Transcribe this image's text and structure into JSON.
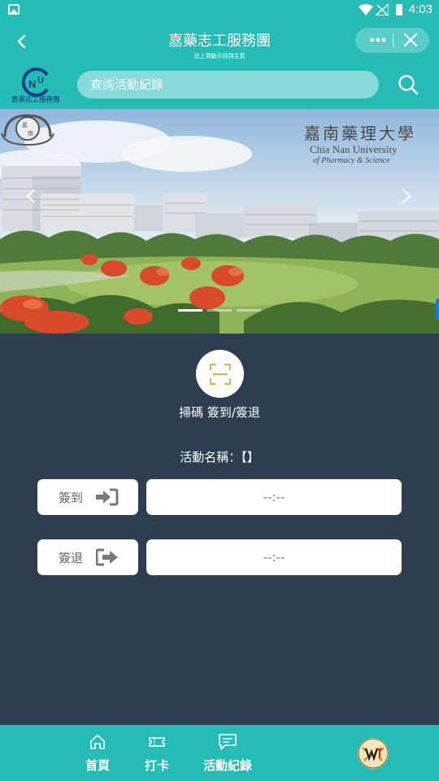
{
  "status_bar": {
    "time": "4:03"
  },
  "header": {
    "title": "嘉藥志工服務團",
    "subtitle": "往上滑動示回到主頁",
    "more_icon": "more-dots-icon",
    "close_icon": "close-icon"
  },
  "search": {
    "placeholder": "查詢活動紀錄",
    "logo_text": "嘉藥志工服務團"
  },
  "banner": {
    "university_cn": "嘉南藥理大學",
    "university_en": "Chia Nan University",
    "university_en2": "of Pharmacy & Science",
    "slides": 3,
    "active_slide": 1
  },
  "scan": {
    "label": "掃碼 簽到/簽退"
  },
  "activity": {
    "label": "活動名稱：【】"
  },
  "checkin": {
    "label": "簽到",
    "time": "--:--"
  },
  "checkout": {
    "label": "簽退",
    "time": "--:--"
  },
  "tabs": [
    {
      "label": "首頁",
      "icon": "home-icon"
    },
    {
      "label": "打卡",
      "icon": "ticket-icon"
    },
    {
      "label": "活動紀錄",
      "icon": "chat-record-icon"
    }
  ],
  "colors": {
    "primary": "#25bcb6",
    "background": "#2c3e50",
    "scan_accent": "#e3b04b"
  }
}
